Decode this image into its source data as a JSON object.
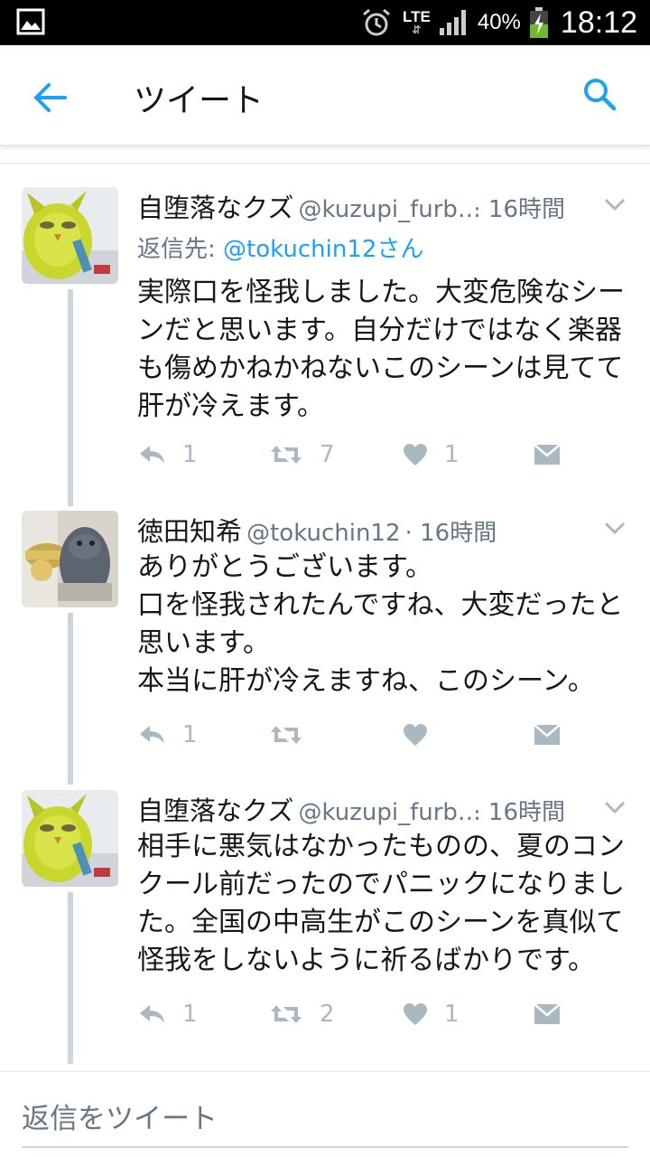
{
  "status_bar": {
    "network": "LTE",
    "battery_percent": "40%",
    "time": "18:12",
    "icons": [
      "gallery-icon",
      "alarm-icon",
      "signal-icon",
      "battery-charging-icon"
    ]
  },
  "app_bar": {
    "title": "ツイート",
    "icons": [
      "back-arrow-icon",
      "search-icon"
    ]
  },
  "tweets": [
    {
      "name": "自堕落なクズ",
      "handle": "@kuzupi_furb…",
      "time": "· 16時間",
      "reply_prefix": "返信先: ",
      "reply_to": "@tokuchin12さん",
      "lines": [
        "実際口を怪我しました。大変危険なシー",
        "ンだと思います。自分だけではなく楽器",
        "も傷めかねかねないこのシーンは見てて",
        "肝が冷えます。"
      ],
      "reply_count": "1",
      "retweet_count": "7",
      "like_count": "1"
    },
    {
      "name": "徳田知希",
      "handle": "@tokuchin12",
      "time": "· 16時間",
      "lines": [
        "ありがとうございます。",
        "口を怪我されたんですね、大変だったと",
        "思います。",
        "本当に肝が冷えますね、このシーン。"
      ],
      "reply_count": "1",
      "retweet_count": "",
      "like_count": ""
    },
    {
      "name": "自堕落なクズ",
      "handle": "@kuzupi_furb…",
      "time": "· 16時間",
      "lines": [
        "相手に悪気はなかったものの、夏のコン",
        "クール前だったのでパニックになりまし",
        "た。全国の中高生がこのシーンを真似て",
        "怪我をしないように祈るばかりです。"
      ],
      "reply_count": "1",
      "retweet_count": "2",
      "like_count": "1"
    }
  ],
  "composer": {
    "placeholder": "返信をツイート"
  },
  "colors": {
    "accent": "#1da1f2",
    "muted": "#657786",
    "icon_gray": "#aab8c2",
    "thread_line": "#ccd6dd",
    "avatar_furby": "#c9d62e"
  }
}
